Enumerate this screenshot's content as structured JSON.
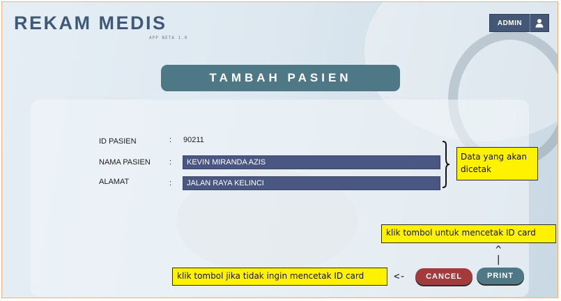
{
  "header": {
    "app_title": "REKAM MEDIS",
    "app_version": "APP BETA 1.0",
    "admin_label": "ADMIN",
    "user_icon": "user-icon"
  },
  "page": {
    "title": "TAMBAH PASIEN"
  },
  "form": {
    "colon": ":",
    "id_label": "ID PASIEN",
    "id_value": "90211",
    "name_label": "NAMA PASIEN",
    "name_value": "KEVIN MIRANDA AZIS",
    "address_label": "ALAMAT",
    "address_value": "JALAN RAYA KELINCI"
  },
  "annotations": {
    "data_note": "Data yang akan dicetak",
    "print_note": "klik tombol untuk mencetak ID card",
    "print_arrow": "^\n|",
    "cancel_note": "klik tombol jika tidak ingin mencetak ID card",
    "cancel_arrow": "<-"
  },
  "actions": {
    "cancel_label": "CANCEL",
    "print_label": "PRINT"
  },
  "colors": {
    "title_color": "#3e5a78",
    "banner": "#4f7887",
    "admin_bg": "#445777",
    "input_bg": "#4a5783",
    "cancel_bg": "#a33a3c",
    "note_bg": "#fff200"
  }
}
